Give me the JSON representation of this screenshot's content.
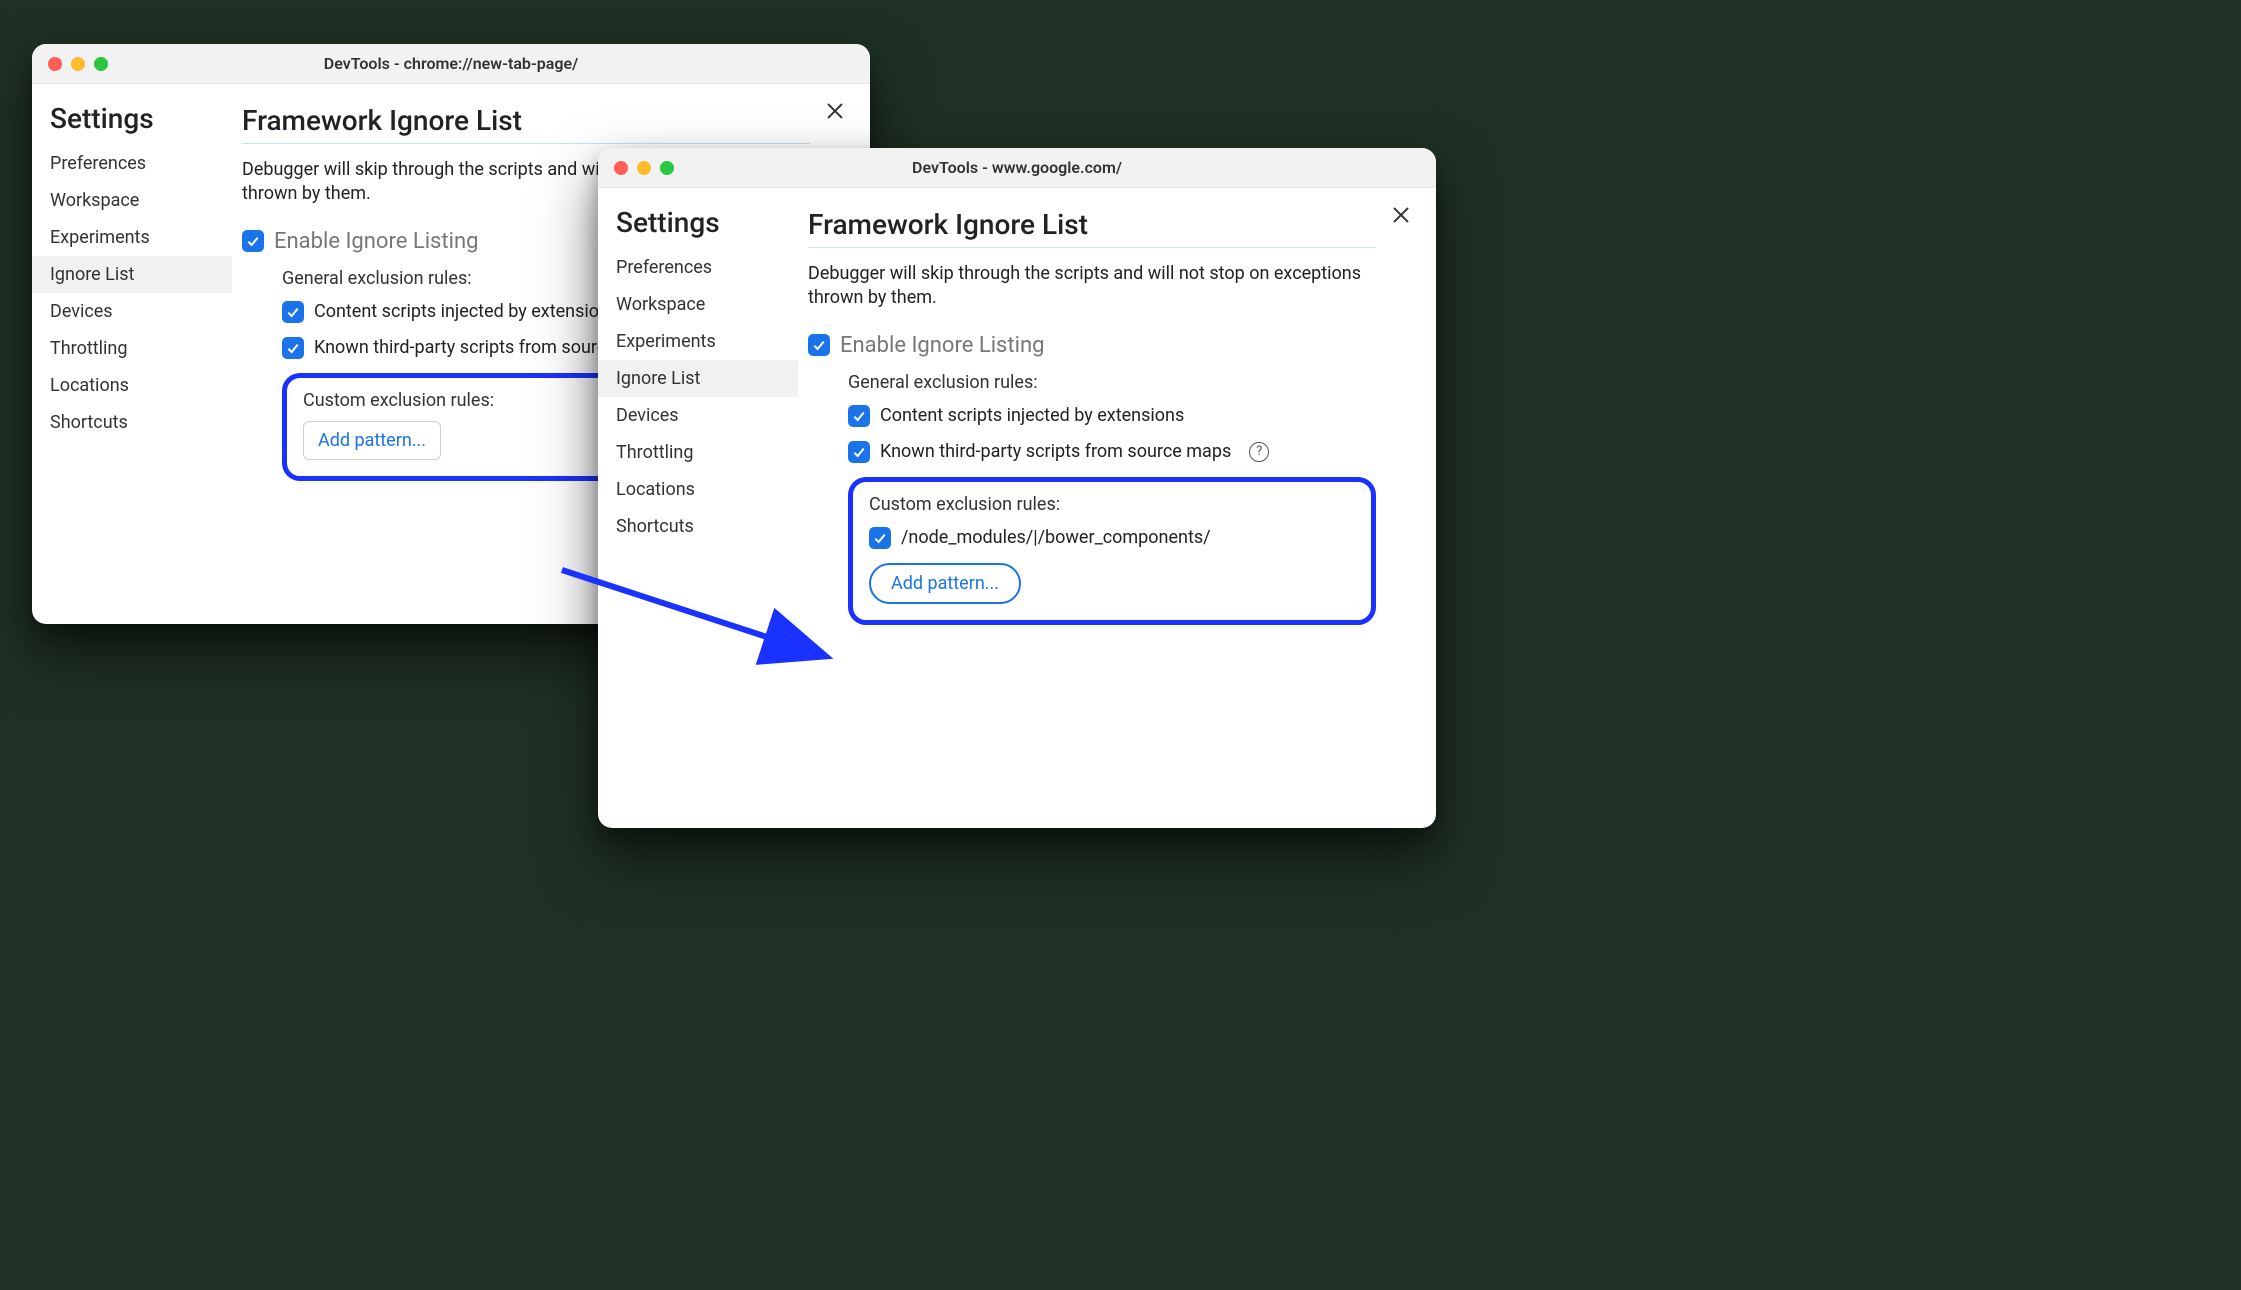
{
  "window1": {
    "title": "DevTools - chrome://new-tab-page/",
    "sidebar": {
      "heading": "Settings",
      "items": [
        "Preferences",
        "Workspace",
        "Experiments",
        "Ignore List",
        "Devices",
        "Throttling",
        "Locations",
        "Shortcuts"
      ],
      "activeIndex": 3
    },
    "content": {
      "title": "Framework Ignore List",
      "description": "Debugger will skip through the scripts and will not stop on exceptions thrown by them.",
      "enable_label": "Enable Ignore Listing",
      "general_heading": "General exclusion rules:",
      "rule_content_scripts": "Content scripts injected by extensions",
      "rule_thirdparty": "Known third-party scripts from source maps",
      "custom_heading": "Custom exclusion rules:",
      "add_pattern": "Add pattern..."
    }
  },
  "window2": {
    "title": "DevTools - www.google.com/",
    "sidebar": {
      "heading": "Settings",
      "items": [
        "Preferences",
        "Workspace",
        "Experiments",
        "Ignore List",
        "Devices",
        "Throttling",
        "Locations",
        "Shortcuts"
      ],
      "activeIndex": 3
    },
    "content": {
      "title": "Framework Ignore List",
      "description": "Debugger will skip through the scripts and will not stop on exceptions thrown by them.",
      "enable_label": "Enable Ignore Listing",
      "general_heading": "General exclusion rules:",
      "rule_content_scripts": "Content scripts injected by extensions",
      "rule_thirdparty": "Known third-party scripts from source maps",
      "custom_heading": "Custom exclusion rules:",
      "custom_pattern": "/node_modules/|/bower_components/",
      "add_pattern": "Add pattern..."
    }
  }
}
